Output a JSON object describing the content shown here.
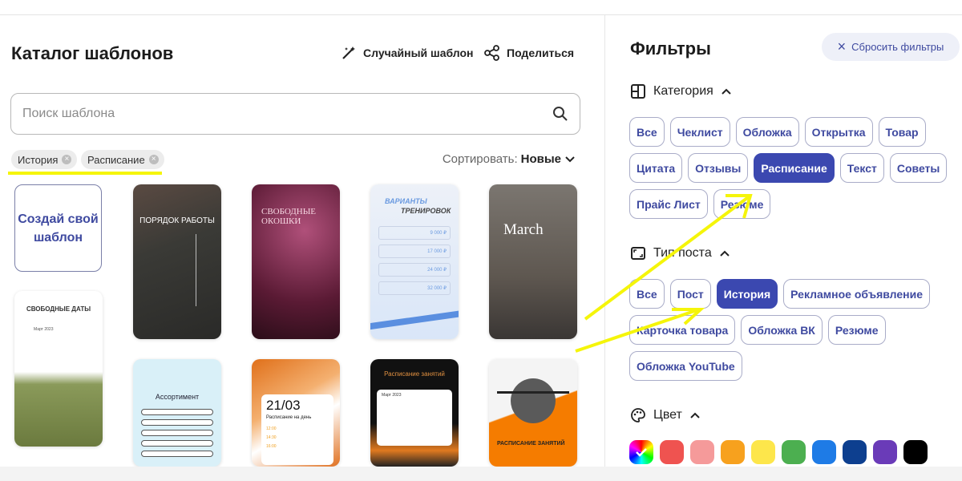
{
  "catalog": {
    "title": "Каталог шаблонов",
    "random_label": "Случайный шаблон",
    "share_label": "Поделиться",
    "search_placeholder": "Поиск шаблона",
    "active_tags": [
      "История",
      "Расписание"
    ],
    "sort_label": "Сортировать:",
    "sort_value": "Новые",
    "create_label": "Создай свой шаблон",
    "templates": [
      {
        "headline": "ПОРЯДОК РАБОТЫ"
      },
      {
        "headline": "СВОБОДНЫЕ ОКОШКИ"
      },
      {
        "headline": "ВАРИАНТЫ",
        "sub": "ТРЕНИРОВОК",
        "prices": [
          "9 000 ₽",
          "17 000 ₽",
          "24 000 ₽",
          "32 000 ₽"
        ]
      },
      {
        "headline": "March"
      },
      {
        "headline": "СВОБОДНЫЕ ДАТЫ",
        "sub": "Март 2023"
      },
      {
        "headline": "Ассортимент"
      },
      {
        "headline": "21/03",
        "sub": "Расписание на день",
        "times": [
          "12:00",
          "14:30",
          "16:00"
        ]
      },
      {
        "headline": "Расписание занятий",
        "sub": "Март 2023"
      },
      {
        "headline": "РАСПИСАНИЕ ЗАНЯТИЙ"
      }
    ]
  },
  "filters": {
    "title": "Фильтры",
    "reset_label": "Сбросить фильтры",
    "category": {
      "label": "Категория",
      "chips": [
        "Все",
        "Чеклист",
        "Обложка",
        "Открытка",
        "Товар",
        "Цитата",
        "Отзывы",
        "Расписание",
        "Текст",
        "Советы",
        "Прайс Лист",
        "Резюме"
      ],
      "selected": "Расписание"
    },
    "post_type": {
      "label": "Тип поста",
      "chips": [
        "Все",
        "Пост",
        "История",
        "Рекламное объявление",
        "Карточка товара",
        "Обложка ВК",
        "Резюме",
        "Обложка YouTube"
      ],
      "selected": "История"
    },
    "color": {
      "label": "Цвет",
      "swatches": [
        "multicolor",
        "#ef5350",
        "#f59a9a",
        "#f7a11e",
        "#fde64b",
        "#4caf50",
        "#1e7be6",
        "#0d3f8f",
        "#6a3bb8",
        "#000000"
      ]
    }
  },
  "accent": "#3b48b0",
  "annotation_color": "#f5f50a"
}
